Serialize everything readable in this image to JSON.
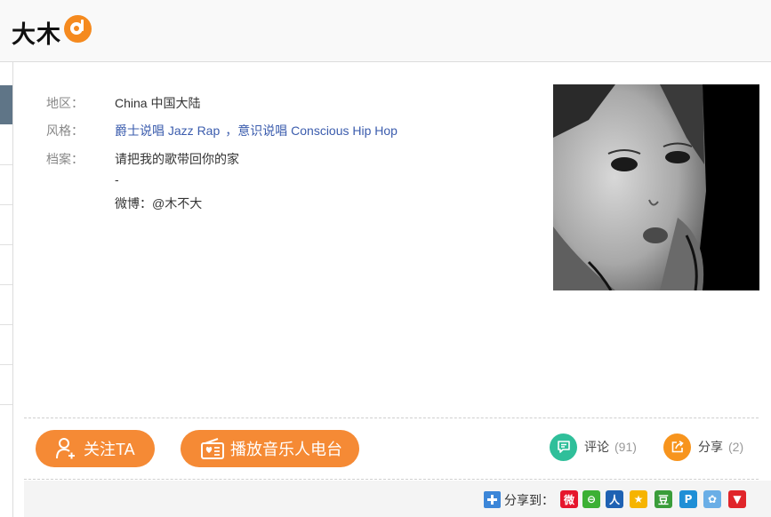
{
  "header": {
    "artist_name": "大木",
    "badge_icon": "music-note-icon",
    "accent": "#f58a1f"
  },
  "info": {
    "region": {
      "label": "地区：",
      "value": "China 中国大陆"
    },
    "genre": {
      "label": "风格：",
      "links": [
        "爵士说唱 Jazz Rap",
        "，意识说唱 Conscious Hip Hop"
      ]
    },
    "bio": {
      "label": "档案：",
      "lines": [
        "请把我的歌带回你的家",
        "-",
        "微博：@木不大"
      ]
    }
  },
  "actions": {
    "follow": {
      "label": "关注TA",
      "icon": "user-plus-icon"
    },
    "radio": {
      "label": "播放音乐人电台",
      "icon": "radio-icon"
    },
    "comments": {
      "label": "评论",
      "count": "(91)",
      "icon": "comment-icon",
      "color": "#2fbf9a"
    },
    "shares": {
      "label": "分享",
      "count": "(2)",
      "icon": "share-icon",
      "color": "#f7941d"
    }
  },
  "share_to": {
    "label": "分享到：",
    "targets": [
      {
        "name": "weibo",
        "glyph": "微",
        "color": "#e6162d"
      },
      {
        "name": "wechat",
        "glyph": "⊖",
        "color": "#3cb034"
      },
      {
        "name": "renren",
        "glyph": "人",
        "color": "#1f62b3"
      },
      {
        "name": "qzone",
        "glyph": "★",
        "color": "#f6b400"
      },
      {
        "name": "douban",
        "glyph": "豆",
        "color": "#3a9d3a"
      },
      {
        "name": "pengyou",
        "glyph": "P",
        "color": "#1f8fd6"
      },
      {
        "name": "tencent-weibo",
        "glyph": "✿",
        "color": "#6aaee6"
      },
      {
        "name": "pocket",
        "glyph": "▼",
        "color": "#e0252a"
      }
    ]
  }
}
